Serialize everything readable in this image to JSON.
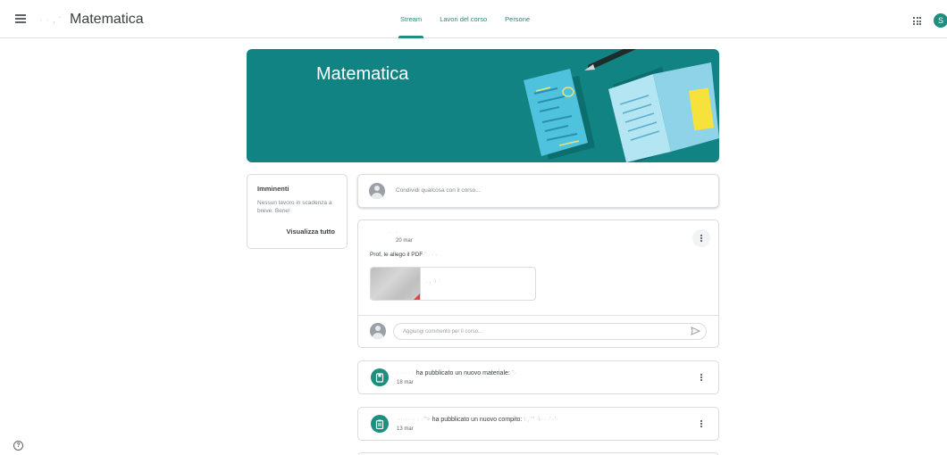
{
  "header": {
    "course_prefix": "· · , '",
    "course_title": "Matematica",
    "tabs": [
      {
        "label": "Stream",
        "active": true
      },
      {
        "label": "Lavori del corso",
        "active": false
      },
      {
        "label": "Persone",
        "active": false
      }
    ],
    "avatar_letter": "S",
    "icons": {
      "menu": "hamburger-menu-icon",
      "apps": "apps-grid-icon"
    }
  },
  "banner": {
    "title": "Matematica"
  },
  "upcoming": {
    "title": "Imminenti",
    "text": "Nessun lavoro in scadenza a breve. Bene!",
    "link": "Visualizza tutto"
  },
  "share": {
    "placeholder": "Condividi qualcosa con il corso..."
  },
  "post": {
    "author": "·   ·       -",
    "date": "20 mar",
    "text": "Prof, le allego il PDF",
    "text_blurred": " ''  ·   ·   -",
    "attachment_name": ".  ,  ·\\ ·'",
    "comment_placeholder": "Aggiungi commento per il corso..."
  },
  "activities": [
    {
      "name_blurred": "·   ···   ·   ·",
      "title": " ha pubblicato un nuovo materiale: ",
      "title_blurred_tail": "''·",
      "date": "18 mar",
      "icon": "material-book-icon"
    },
    {
      "name_blurred": "·········  ·  ·'''>",
      "title": " ha pubblicato un nuovo compito: ",
      "title_blurred_tail": "\\ , '''          ·\\· ·  ·'  ·'·",
      "date": "13 mar",
      "icon": "assignment-clipboard-icon"
    }
  ],
  "help": {
    "label": "?"
  },
  "colors": {
    "accent": "#1e8e7e",
    "banner": "#128383"
  }
}
